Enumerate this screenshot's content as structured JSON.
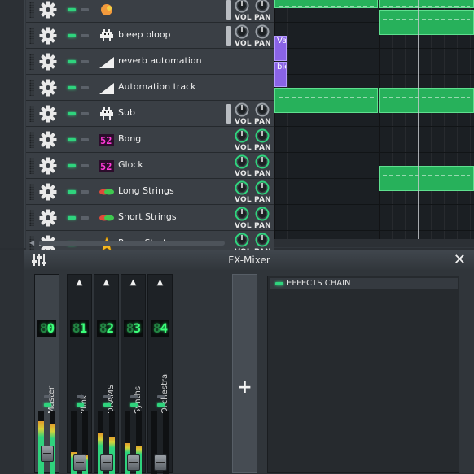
{
  "song_editor": {
    "knob_labels": {
      "vol": "VOL",
      "pan": "PAN"
    },
    "tracks": [
      {
        "name": "",
        "icon": "orange-blob-icon",
        "knob_style": "dark"
      },
      {
        "name": "bleep bloop",
        "icon": "space-invader-icon",
        "knob_style": "dark"
      },
      {
        "name": "reverb automation",
        "icon": "automation-ramp-icon",
        "knob_style": "none"
      },
      {
        "name": "Automation track",
        "icon": "automation-ramp-icon",
        "knob_style": "none"
      },
      {
        "name": "Sub",
        "icon": "space-invader-icon",
        "knob_style": "dark"
      },
      {
        "name": "Bong",
        "icon": "magenta-lcd-icon",
        "knob_style": "green"
      },
      {
        "name": "Glock",
        "icon": "magenta-lcd-icon",
        "knob_style": "green"
      },
      {
        "name": "Long Strings",
        "icon": "red-green-ribbon-icon",
        "knob_style": "green"
      },
      {
        "name": "Short Strings",
        "icon": "red-green-ribbon-icon",
        "knob_style": "green"
      },
      {
        "name": "Press Start",
        "icon": "star-icon",
        "knob_style": "green"
      }
    ],
    "automation_clip_labels": [
      "Va",
      "ble"
    ]
  },
  "fx_mixer": {
    "title": "FX-Mixer",
    "channels": [
      {
        "lcd": "0",
        "name": "Master",
        "level": 0.85
      },
      {
        "lcd": "1",
        "name": "Plink",
        "level": 0.35
      },
      {
        "lcd": "2",
        "name": "DRAMS",
        "level": 0.65
      },
      {
        "lcd": "3",
        "name": "Synths",
        "level": 0.5
      },
      {
        "lcd": "4",
        "name": "Orchestra",
        "level": 0.0
      }
    ],
    "add_label": "+",
    "effects_chain_label": "EFFECTS CHAIN"
  },
  "colors": {
    "accent_green": "#2fd37d",
    "clip_green": "#27b15b",
    "automation_purple": "#8a63e6",
    "lcd_green": "#3cff7a"
  }
}
